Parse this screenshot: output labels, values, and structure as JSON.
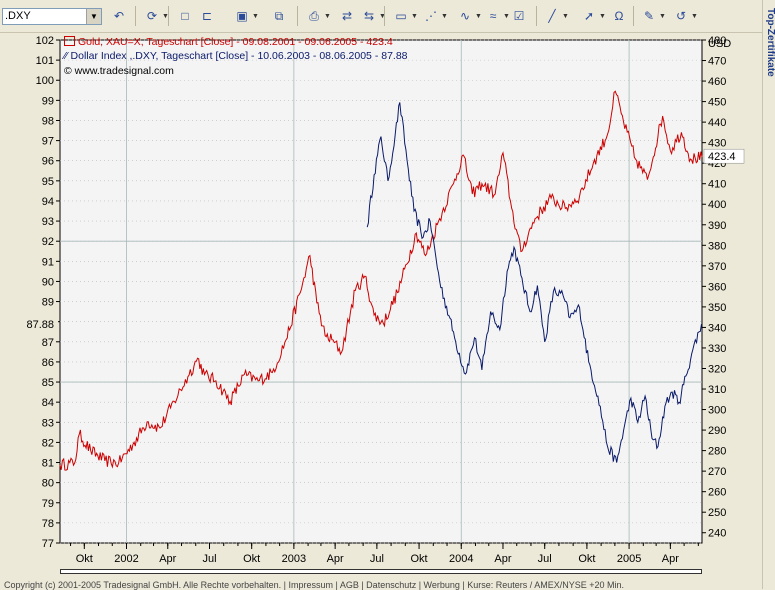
{
  "toolbar": {
    "symbol": ".DXY",
    "buttons": [
      "back-icon",
      "refresh-icon",
      "new-icon",
      "open-icon",
      "save-icon",
      "copy-icon",
      "print-icon",
      "chart-a-icon",
      "chart-b-icon",
      "window-icon",
      "indicator-icon",
      "study-icon",
      "drawing-icon",
      "properties-icon",
      "line-tool-icon",
      "cursor-icon",
      "magnet-icon",
      "note-icon",
      "undo-icon"
    ]
  },
  "side_label": "Top-Zertifikate",
  "legend": {
    "gold": "Gold, XAU=X, Tageschart [Close] - 09.08.2001 - 09.06.2005 - 423.4",
    "dxy": "Dollar Index ,.DXY, Tageschart [Close] - 10.06.2003 - 08.06.2005 - 87.88",
    "source": "© www.tradesignal.com"
  },
  "colors": {
    "gold": "#cc0000",
    "dxy": "#0a1a6a",
    "plot_bg": "#f4f4f4"
  },
  "chart_data": {
    "type": "line",
    "x_ticks": [
      "Okt",
      "2002",
      "Apr",
      "Jul",
      "Okt",
      "2003",
      "Apr",
      "Jul",
      "Okt",
      "2004",
      "Apr",
      "Jul",
      "Okt",
      "2005",
      "Apr"
    ],
    "left_axis": {
      "label": "",
      "range": [
        77,
        102
      ],
      "ticks": [
        77,
        78,
        79,
        80,
        81,
        82,
        83,
        84,
        85,
        86,
        87,
        88,
        89,
        90,
        91,
        92,
        93,
        94,
        95,
        96,
        97,
        98,
        99,
        100,
        101,
        102
      ]
    },
    "right_axis": {
      "label": "USD",
      "range": [
        235,
        480
      ],
      "ticks": [
        240,
        250,
        260,
        270,
        280,
        290,
        300,
        310,
        320,
        330,
        340,
        350,
        360,
        370,
        380,
        390,
        400,
        410,
        420,
        430,
        440,
        450,
        460,
        470,
        480
      ]
    },
    "last_left": "87.88",
    "last_right": "423.4",
    "series": [
      {
        "name": "Gold, XAU=X",
        "axis": "right",
        "points": [
          [
            "2001-08-09",
            273
          ],
          [
            "2001-09-10",
            274
          ],
          [
            "2001-09-20",
            288
          ],
          [
            "2001-10-15",
            280
          ],
          [
            "2001-11-15",
            275
          ],
          [
            "2001-12-15",
            274
          ],
          [
            "2002-01-15",
            283
          ],
          [
            "2002-02-15",
            294
          ],
          [
            "2002-03-15",
            291
          ],
          [
            "2002-04-15",
            304
          ],
          [
            "2002-05-15",
            316
          ],
          [
            "2002-06-05",
            325
          ],
          [
            "2002-06-20",
            317
          ],
          [
            "2002-07-15",
            314
          ],
          [
            "2002-08-15",
            304
          ],
          [
            "2002-09-15",
            317
          ],
          [
            "2002-10-15",
            314
          ],
          [
            "2002-11-15",
            318
          ],
          [
            "2002-12-15",
            334
          ],
          [
            "2003-01-15",
            357
          ],
          [
            "2003-02-05",
            375
          ],
          [
            "2003-02-20",
            352
          ],
          [
            "2003-03-10",
            336
          ],
          [
            "2003-03-25",
            334
          ],
          [
            "2003-04-15",
            328
          ],
          [
            "2003-05-15",
            358
          ],
          [
            "2003-06-05",
            365
          ],
          [
            "2003-06-25",
            346
          ],
          [
            "2003-07-15",
            342
          ],
          [
            "2003-08-15",
            357
          ],
          [
            "2003-09-25",
            386
          ],
          [
            "2003-10-15",
            375
          ],
          [
            "2003-11-15",
            393
          ],
          [
            "2003-12-15",
            410
          ],
          [
            "2004-01-05",
            424
          ],
          [
            "2004-01-25",
            405
          ],
          [
            "2004-02-15",
            410
          ],
          [
            "2004-03-15",
            405
          ],
          [
            "2004-04-01",
            425
          ],
          [
            "2004-04-20",
            398
          ],
          [
            "2004-05-10",
            377
          ],
          [
            "2004-06-10",
            393
          ],
          [
            "2004-07-15",
            403
          ],
          [
            "2004-08-15",
            398
          ],
          [
            "2004-09-15",
            404
          ],
          [
            "2004-10-15",
            420
          ],
          [
            "2004-11-15",
            434
          ],
          [
            "2004-12-02",
            455
          ],
          [
            "2004-12-20",
            440
          ],
          [
            "2005-01-15",
            422
          ],
          [
            "2005-02-10",
            412
          ],
          [
            "2005-03-15",
            443
          ],
          [
            "2005-04-01",
            426
          ],
          [
            "2005-04-25",
            435
          ],
          [
            "2005-05-15",
            422
          ],
          [
            "2005-06-09",
            423
          ]
        ]
      },
      {
        "name": "Dollar Index ,.DXY",
        "axis": "left",
        "points": [
          [
            "2003-06-10",
            92.7
          ],
          [
            "2003-06-25",
            95.3
          ],
          [
            "2003-07-10",
            97.2
          ],
          [
            "2003-07-25",
            95.0
          ],
          [
            "2003-08-10",
            97.3
          ],
          [
            "2003-08-20",
            98.9
          ],
          [
            "2003-09-05",
            96.0
          ],
          [
            "2003-09-20",
            93.5
          ],
          [
            "2003-10-10",
            92.2
          ],
          [
            "2003-10-25",
            93.0
          ],
          [
            "2003-11-15",
            90.0
          ],
          [
            "2003-12-05",
            88.3
          ],
          [
            "2003-12-20",
            87.0
          ],
          [
            "2004-01-10",
            85.4
          ],
          [
            "2004-01-30",
            87.2
          ],
          [
            "2004-02-15",
            85.6
          ],
          [
            "2004-03-05",
            88.5
          ],
          [
            "2004-03-25",
            87.6
          ],
          [
            "2004-04-10",
            90.5
          ],
          [
            "2004-04-25",
            91.7
          ],
          [
            "2004-05-10",
            90.3
          ],
          [
            "2004-05-30",
            88.5
          ],
          [
            "2004-06-15",
            89.8
          ],
          [
            "2004-07-01",
            87.0
          ],
          [
            "2004-07-20",
            89.5
          ],
          [
            "2004-08-10",
            89.3
          ],
          [
            "2004-08-25",
            88.2
          ],
          [
            "2004-09-15",
            88.7
          ],
          [
            "2004-10-05",
            86.0
          ],
          [
            "2004-10-25",
            84.3
          ],
          [
            "2004-11-15",
            81.8
          ],
          [
            "2004-12-05",
            81.0
          ],
          [
            "2004-12-20",
            82.6
          ],
          [
            "2005-01-05",
            84.2
          ],
          [
            "2005-01-20",
            83.0
          ],
          [
            "2005-02-05",
            84.3
          ],
          [
            "2005-02-20",
            82.2
          ],
          [
            "2005-03-05",
            81.8
          ],
          [
            "2005-03-20",
            83.8
          ],
          [
            "2005-04-05",
            84.5
          ],
          [
            "2005-04-20",
            84.0
          ],
          [
            "2005-05-05",
            85.3
          ],
          [
            "2005-05-20",
            86.6
          ],
          [
            "2005-06-08",
            87.88
          ]
        ]
      }
    ]
  },
  "copyright": "Copyright (c) 2001-2005 Tradesignal GmbH. Alle Rechte vorbehalten. | Impressum | AGB | Datenschutz | Werbung | Kurse: Reuters / AMEX/NYSE +20 Min."
}
